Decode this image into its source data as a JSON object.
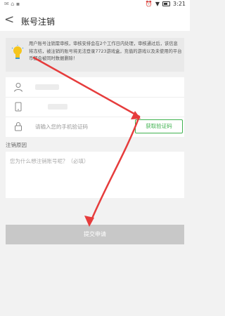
{
  "status_bar": {
    "time": "3:21"
  },
  "header": {
    "back_glyph": "<",
    "title": "账号注销"
  },
  "notice": {
    "icon": "lightbulb-icon",
    "text": "用户账号注销需审核，审核安排会在2个工作日内处理，审核通过后，该信息将冻结，被注销的账号将无法登录7723游戏盒，充值的游戏以及未使用的平台币都会被同时数据删除！"
  },
  "form": {
    "user_icon": "user-icon",
    "phone_icon": "phone-icon",
    "lock_icon": "lock-icon",
    "code_placeholder": "请输入您的手机验证码",
    "get_code_label": "获取验证码"
  },
  "reason": {
    "label": "注销原因",
    "placeholder": "您为什么想注销账号呢？（必填）"
  },
  "submit_label": "提交申请",
  "colors": {
    "accent_green": "#3fb24f",
    "annotation_red": "#e63c3c",
    "submit_bg": "#c8c8c8"
  }
}
